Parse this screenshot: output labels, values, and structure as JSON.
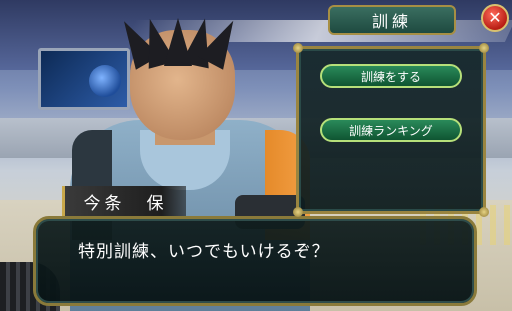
{
  "character": {
    "name": "今条　保"
  },
  "dialogue": {
    "text": "特別訓練、いつでもいけるぞ？"
  },
  "menu": {
    "title": "訓練",
    "buttons": [
      {
        "label": "訓練をする"
      },
      {
        "label": "訓練ランキング"
      }
    ]
  },
  "close_button": {
    "symbol": "✕",
    "icon": "close-icon"
  },
  "colors": {
    "frame_gold": "#9a8540",
    "button_green": "#2a8a5a",
    "button_border": "#b6e07a",
    "close_red": "#d02a1e",
    "jacket_orange": "#e58a2a"
  }
}
